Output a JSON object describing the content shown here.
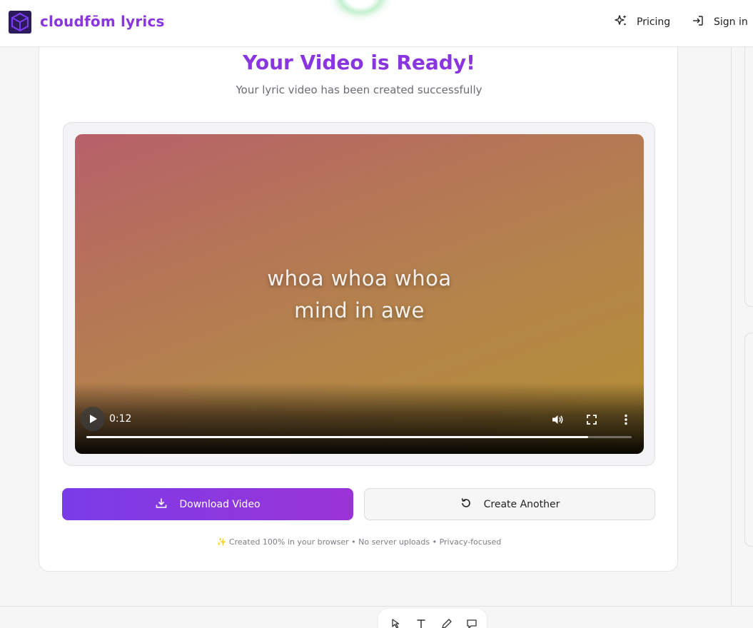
{
  "header": {
    "brand": "cloudfōm lyrics",
    "nav": [
      {
        "label": "Pricing",
        "icon": "sparkles-icon"
      },
      {
        "label": "Sign in",
        "icon": "sign-in-icon"
      }
    ]
  },
  "main": {
    "title": "Your Video is Ready!",
    "subtitle": "Your lyric video has been created successfully",
    "video": {
      "lyrics_line1": "whoa whoa whoa",
      "lyrics_line2": "mind in awe",
      "current_time": "0:12",
      "progress_fraction": 0.92
    },
    "buttons": {
      "download_label": "Download Video",
      "create_label": "Create Another"
    },
    "footer_note": "✨ Created 100% in your browser • No server uploads • Privacy-focused"
  },
  "colors": {
    "accent": "#8a36e0",
    "button_gradient_start": "#7a3ce8",
    "button_gradient_end": "#9a34d6"
  },
  "toolbar": {
    "tools": [
      "select-icon",
      "text-icon",
      "pen-icon",
      "comment-icon"
    ]
  }
}
